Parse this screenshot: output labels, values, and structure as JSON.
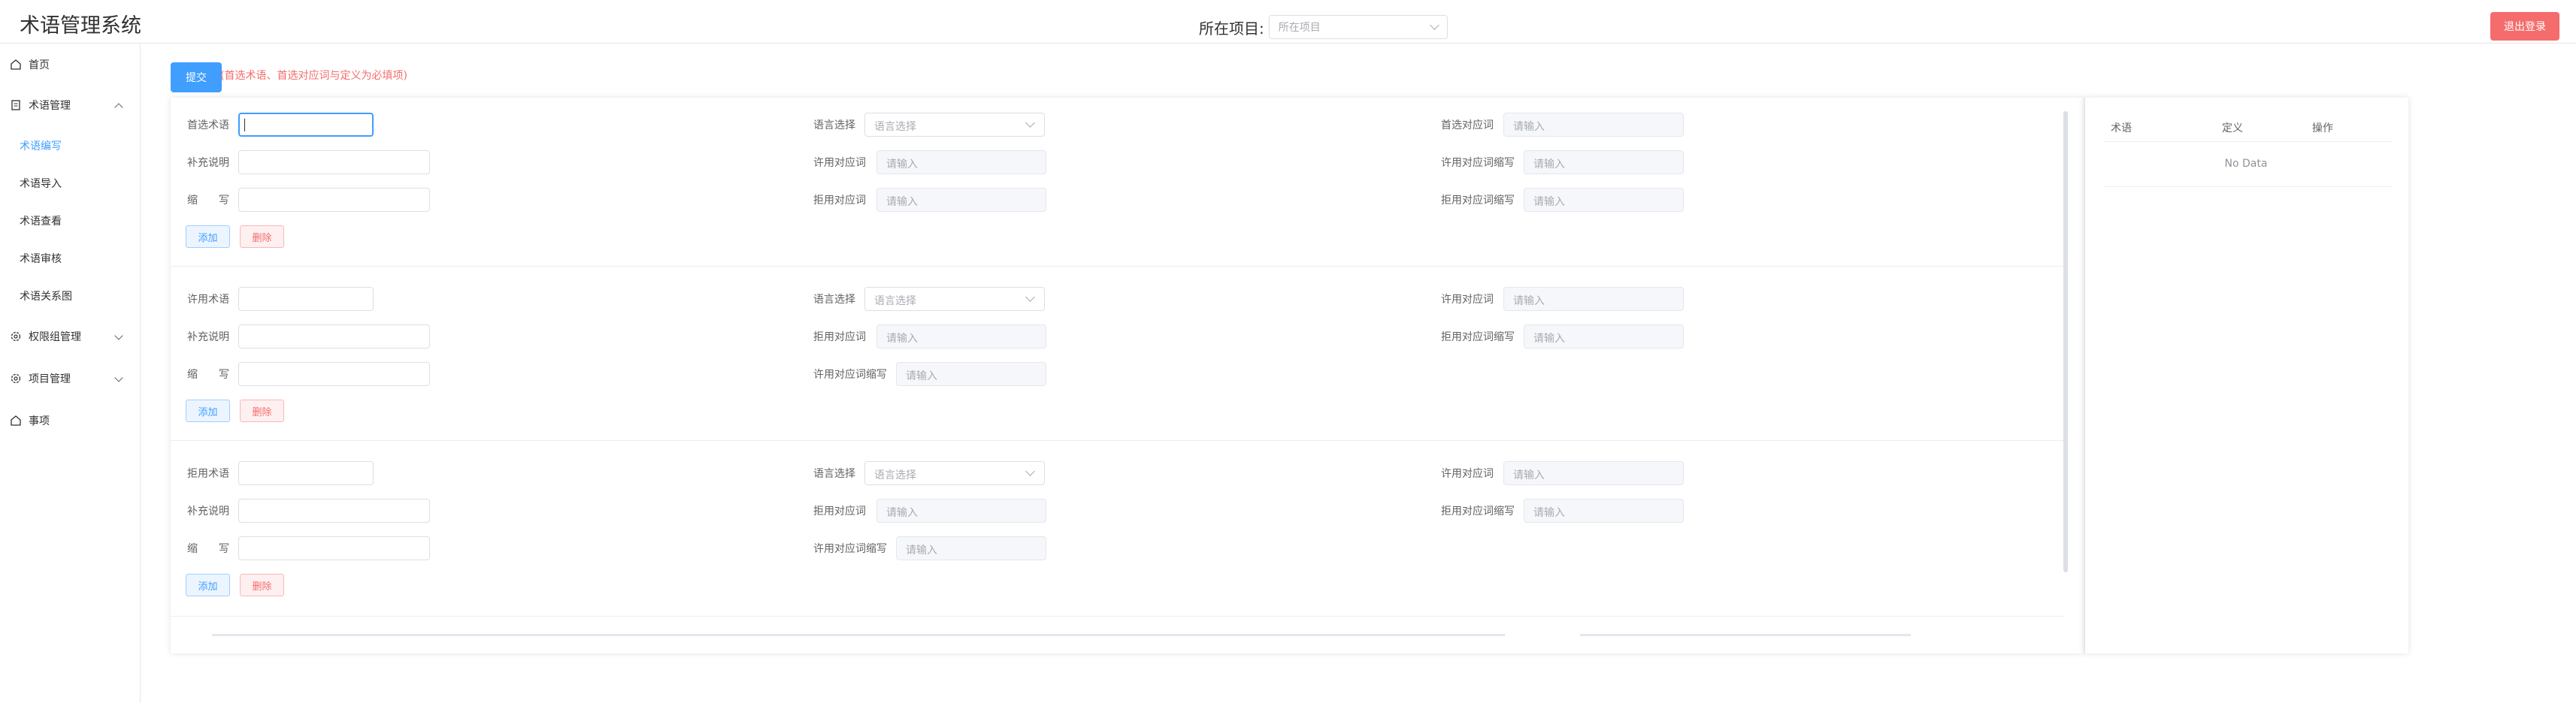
{
  "header": {
    "title": "术语管理系统",
    "project_label": "所在项目:",
    "project_placeholder": "所在项目",
    "logout_label": "退出登录"
  },
  "sidebar": {
    "home": "首页",
    "term_mgmt": "术语管理",
    "term_sub": [
      "术语编写",
      "术语导入",
      "术语查看",
      "术语审核",
      "术语关系图"
    ],
    "perm_group": "权限组管理",
    "project_mgmt": "项目管理",
    "items_label": "事项"
  },
  "form": {
    "submit_label": "提交",
    "hint": "(首选术语、首选对应词与定义为必填项)",
    "placeholder_input": "请输入",
    "placeholder_lang": "语言选择",
    "add_label": "添加",
    "delete_label": "删除",
    "sections": [
      {
        "term_label": "首选术语",
        "supplement_label": "补充说明",
        "abbr_label": "缩　　写",
        "lang_label": "语言选择",
        "mid_labels": [
          "许用对应词",
          "拒用对应词"
        ],
        "right_labels": [
          "首选对应词",
          "许用对应词缩写",
          "拒用对应词缩写"
        ]
      },
      {
        "term_label": "许用术语",
        "supplement_label": "补充说明",
        "abbr_label": "缩　　写",
        "lang_label": "语言选择",
        "mid_labels": [
          "拒用对应词",
          "许用对应词缩写"
        ],
        "right_labels": [
          "许用对应词",
          "拒用对应词缩写"
        ]
      },
      {
        "term_label": "拒用术语",
        "supplement_label": "补充说明",
        "abbr_label": "缩　　写",
        "lang_label": "语言选择",
        "mid_labels": [
          "拒用对应词",
          "许用对应词缩写"
        ],
        "right_labels": [
          "许用对应词",
          "拒用对应词缩写"
        ]
      }
    ]
  },
  "table": {
    "columns": [
      "术语",
      "定义",
      "操作"
    ],
    "empty_text": "No Data"
  },
  "colors": {
    "primary": "#409eff",
    "danger": "#f56c6c"
  }
}
